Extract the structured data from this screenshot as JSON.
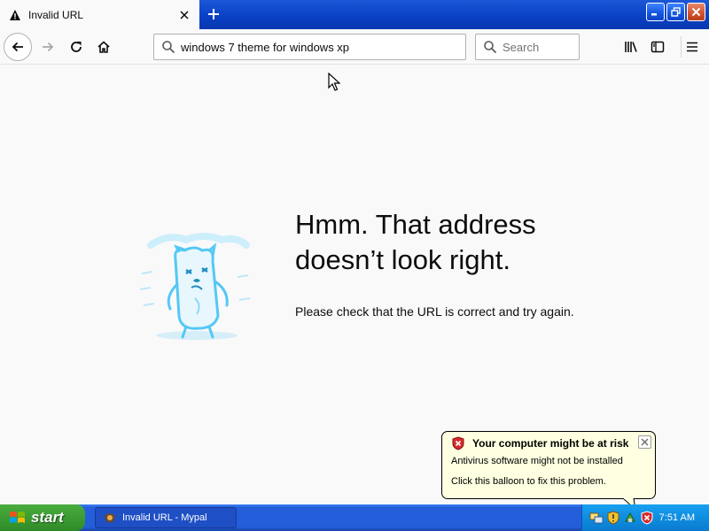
{
  "tab": {
    "title": "Invalid URL",
    "icon": "warning-icon"
  },
  "navbar": {
    "url": "windows 7 theme for windows xp",
    "search_placeholder": "Search"
  },
  "error": {
    "headline_line1": "Hmm. That address",
    "headline_line2": "doesn’t look right.",
    "message": "Please check that the URL is correct and try again."
  },
  "balloon": {
    "title": "Your computer might be at risk",
    "line1": "Antivirus software might not be installed",
    "line2": "Click this balloon to fix this problem."
  },
  "taskbar": {
    "start_label": "start",
    "task_label": "Invalid URL - Mypal",
    "clock": "7:51 AM"
  },
  "colors": {
    "titlebar": "#0a3fc4",
    "taskbar": "#245edb",
    "start": "#3c9c33",
    "tray": "#0f8de0",
    "balloon": "#ffffe1",
    "illustration": "#54c8f5"
  }
}
